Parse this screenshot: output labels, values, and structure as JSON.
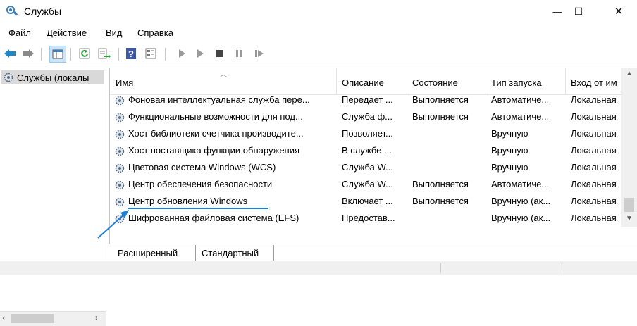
{
  "window": {
    "title": "Службы",
    "controls": {
      "minimize": "—",
      "maximize": "☐",
      "close": "✕"
    }
  },
  "menu": [
    "Файл",
    "Действие",
    "Вид",
    "Справка"
  ],
  "tree": {
    "root_label": "Службы (локалы"
  },
  "table": {
    "columns": [
      "Имя",
      "Описание",
      "Состояние",
      "Тип запуска",
      "Вход от им"
    ],
    "rows": [
      [
        "Фоновая интеллектуальная служба пере...",
        "Передает ...",
        "Выполняется",
        "Автоматиче...",
        "Локальная"
      ],
      [
        "Функциональные возможности для под...",
        "Служба ф...",
        "Выполняется",
        "Автоматиче...",
        "Локальная"
      ],
      [
        "Хост библиотеки счетчика производите...",
        "Позволяет...",
        "",
        "Вручную",
        "Локальная"
      ],
      [
        "Хост поставщика функции обнаружения",
        "В службе ...",
        "",
        "Вручную",
        "Локальная"
      ],
      [
        "Цветовая система Windows (WCS)",
        "Служба W...",
        "",
        "Вручную",
        "Локальная"
      ],
      [
        "Центр обеспечения безопасности",
        "Служба W...",
        "Выполняется",
        "Автоматиче...",
        "Локальная"
      ],
      [
        "Центр обновления Windows",
        "Включает ...",
        "Выполняется",
        "Вручную (ак...",
        "Локальная"
      ],
      [
        "Шифрованная файловая система (EFS)",
        "Предостав...",
        "",
        "Вручную (ак...",
        "Локальная"
      ]
    ]
  },
  "tabs": [
    "Расширенный",
    "Стандартный"
  ],
  "colors": {
    "annotation": "#1e7fd6",
    "selection": "#d9d9d9"
  }
}
